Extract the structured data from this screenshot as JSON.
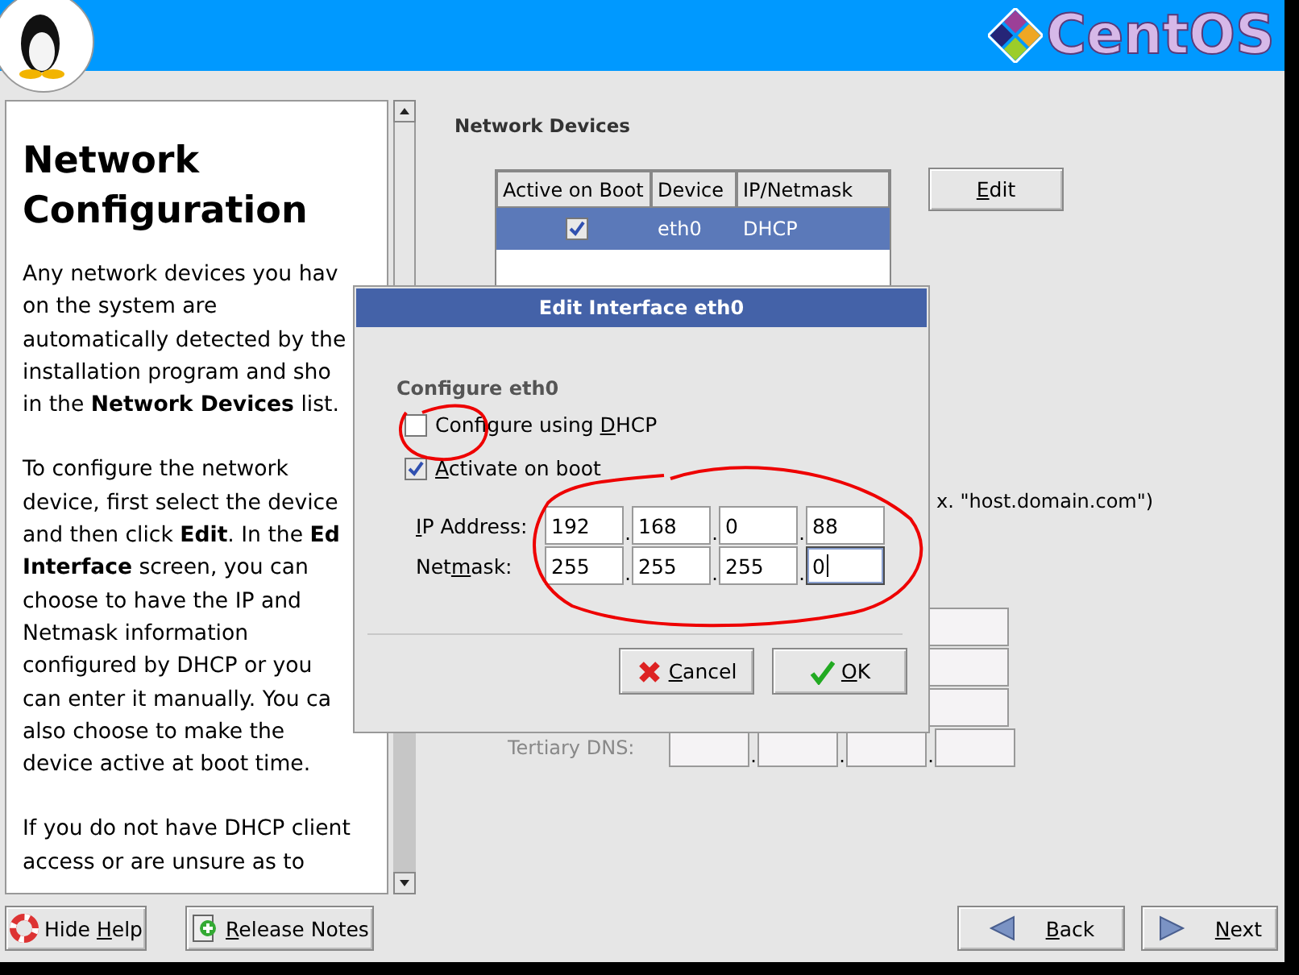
{
  "header": {
    "brand": "CentOS"
  },
  "help": {
    "title": "Network Configuration",
    "paragraphs": [
      [
        "Any network devices you hav",
        "on the system are",
        "automatically detected by the",
        "installation program and sho",
        "in the **Network Devices** list."
      ],
      [
        "To configure the network",
        "device, first select the device",
        "and then click **Edit**. In the **Ed**",
        "**Interface** screen, you can",
        "choose to have the IP and",
        "Netmask information",
        "configured by DHCP or you",
        "can enter it manually. You ca",
        "also choose to make the",
        "device active at boot time."
      ],
      [
        "If you do not have DHCP client",
        "access or are unsure as to"
      ]
    ]
  },
  "network_devices": {
    "title": "Network Devices",
    "columns": [
      "Active on Boot",
      "Device",
      "IP/Netmask"
    ],
    "rows": [
      {
        "active_on_boot": true,
        "device": "eth0",
        "ip_netmask": "DHCP",
        "selected": true
      }
    ],
    "edit_button": {
      "key": "E",
      "after": "dit"
    }
  },
  "hostname_hint": "x. \"host.domain.com\")",
  "dns": {
    "separator": ".",
    "rows": [
      {
        "kind": "covered"
      },
      {
        "kind": "covered"
      },
      {
        "kind": "covered"
      },
      {
        "kind": "labeled",
        "label": "Tertiary DNS:",
        "disabled": true
      }
    ]
  },
  "dialog": {
    "title": "Edit Interface eth0",
    "section": "Configure eth0",
    "separator": ".",
    "options": [
      {
        "label": {
          "before": "Configure using ",
          "key": "D",
          "after": "HCP"
        },
        "checked": false
      },
      {
        "label": {
          "key": "A",
          "after": "ctivate on boot"
        },
        "checked": true
      }
    ],
    "rows": [
      {
        "label": {
          "key": "I",
          "after": "P Address:"
        },
        "octets": [
          {
            "value": "192",
            "focused": false
          },
          {
            "value": "168",
            "focused": false
          },
          {
            "value": "0",
            "focused": false
          },
          {
            "value": "88",
            "focused": false
          }
        ]
      },
      {
        "label": {
          "before": "Net",
          "key": "m",
          "after": "ask:"
        },
        "octets": [
          {
            "value": "255",
            "focused": false
          },
          {
            "value": "255",
            "focused": false
          },
          {
            "value": "255",
            "focused": false
          },
          {
            "value": "0",
            "focused": true
          }
        ]
      }
    ],
    "buttons": [
      {
        "kind": "cancel",
        "label": {
          "key": "C",
          "after": "ancel"
        }
      },
      {
        "kind": "ok",
        "label": {
          "key": "O",
          "after": "K"
        }
      }
    ]
  },
  "footer": {
    "buttons": [
      {
        "kind": "help",
        "label": {
          "before": "Hide ",
          "key": "H",
          "after": "elp"
        }
      },
      {
        "kind": "notes",
        "label": {
          "key": "R",
          "after": "elease Notes"
        }
      },
      {
        "kind": "back",
        "label": {
          "key": "B",
          "after": "ack"
        }
      },
      {
        "kind": "next",
        "label": {
          "key": "N",
          "after": "ext"
        }
      }
    ]
  }
}
